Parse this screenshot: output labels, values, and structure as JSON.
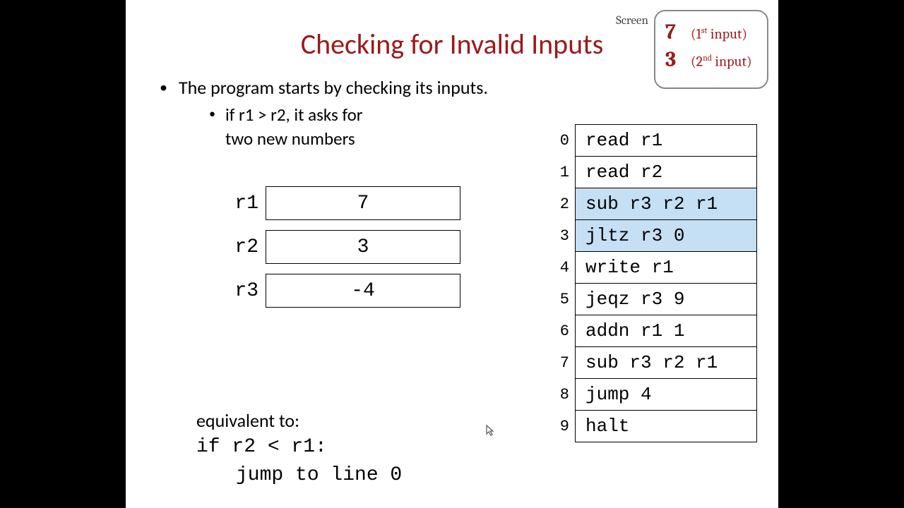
{
  "title": "Checking for Invalid Inputs",
  "bullet1": "The program starts by checking its inputs.",
  "bullet2_line1": "if r1 > r2, it asks for",
  "bullet2_line2": "two new numbers",
  "screen_label": "Screen",
  "screen": [
    {
      "value": "7",
      "label_pre": "(1",
      "label_sup": "st",
      "label_post": " input)"
    },
    {
      "value": "3",
      "label_pre": "(2",
      "label_sup": "nd",
      "label_post": " input)"
    }
  ],
  "registers": [
    {
      "name": "r1",
      "value": "7"
    },
    {
      "name": "r2",
      "value": "3"
    },
    {
      "name": "r3",
      "value": "-4"
    }
  ],
  "equiv_label": "equivalent to:",
  "equiv_code1": "if r2 < r1:",
  "equiv_code2": "jump to line 0",
  "code": [
    {
      "idx": "0",
      "text": "read r1",
      "hl": false
    },
    {
      "idx": "1",
      "text": "read r2",
      "hl": false
    },
    {
      "idx": "2",
      "text": "sub r3 r2 r1",
      "hl": true
    },
    {
      "idx": "3",
      "text": "jltz r3 0",
      "hl": true
    },
    {
      "idx": "4",
      "text": "write r1",
      "hl": false
    },
    {
      "idx": "5",
      "text": "jeqz r3 9",
      "hl": false
    },
    {
      "idx": "6",
      "text": "addn r1 1",
      "hl": false
    },
    {
      "idx": "7",
      "text": "sub r3 r2 r1",
      "hl": false
    },
    {
      "idx": "8",
      "text": "jump 4",
      "hl": false
    },
    {
      "idx": "9",
      "text": "halt",
      "hl": false
    }
  ]
}
